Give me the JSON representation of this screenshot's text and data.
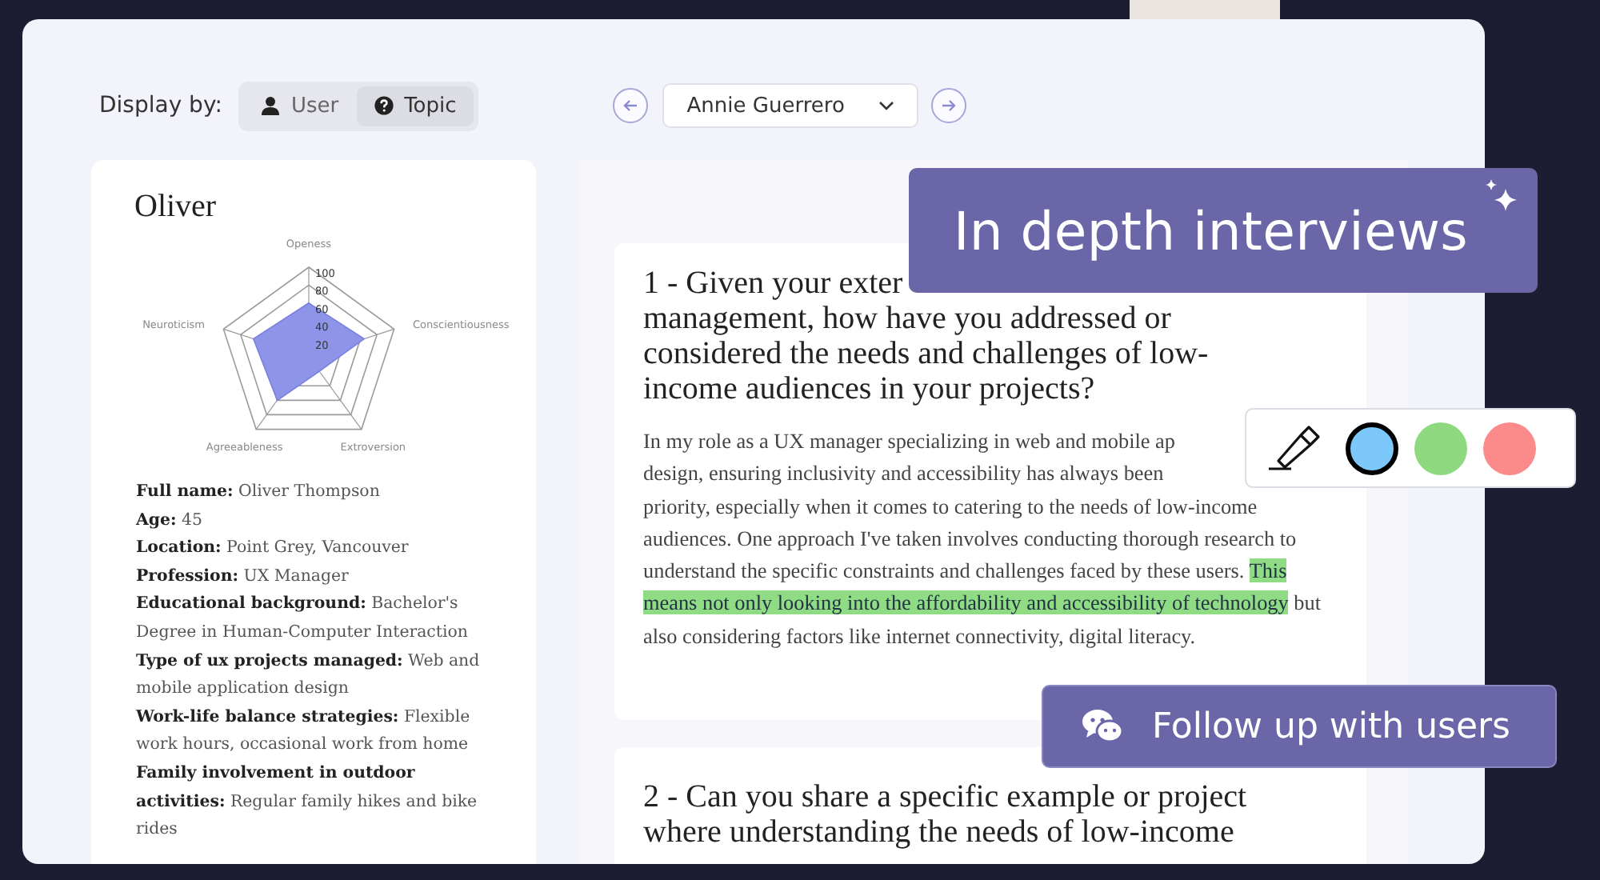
{
  "toolbar": {
    "label": "Display by:",
    "view_toggle": [
      {
        "kind": "user",
        "label": "User",
        "selected": false
      },
      {
        "kind": "topic",
        "label": "Topic",
        "selected": true
      }
    ],
    "participant": {
      "value": "Annie Guerrero"
    }
  },
  "profile": {
    "name": "Oliver",
    "radar_chart": {
      "axis_labels": [
        "Openess",
        "Conscientiousness",
        "Extroversion",
        "Agreeableness",
        "Neuroticism"
      ],
      "tick_labels": [
        "100",
        "80",
        "60",
        "40",
        "20"
      ]
    },
    "fields": [
      {
        "label": "Full name:",
        "value": "Oliver Thompson"
      },
      {
        "label": "Age:",
        "value": "45"
      },
      {
        "label": "Location:",
        "value": "Point Grey, Vancouver"
      },
      {
        "label": "Profession:",
        "value": "UX Manager"
      },
      {
        "label": "Educational background:",
        "value": "Bachelor's Degree in Human-Computer Interaction"
      },
      {
        "label": "Type of ux projects managed:",
        "value": "Web and mobile application design"
      },
      {
        "label": "Work-life balance strategies:",
        "value": "Flexible work hours, occasional work from home"
      },
      {
        "label": "Family involvement in outdoor activities:",
        "value": "Regular family hikes and bike rides"
      }
    ]
  },
  "questions": [
    {
      "heading": [
        "1 - Given your exter",
        "management, how have you addressed or considered the needs and challenges of low-income audiences in your projects?"
      ],
      "answer_lines": [
        "In my role as a UX manager specializing in web and mobile ap",
        "design, ensuring inclusivity and accessibility has always been"
      ],
      "answer": [
        {
          "text": "priority, especially when it comes to catering to the needs of low-income audiences. One approach I've taken involves conducting thorough research to understand the specific constraints and challenges faced by these users. "
        },
        {
          "text": "This means not only looking into the affordability and accessibility of technology",
          "color": "#8fdc84"
        },
        {
          "text": " but also considering factors like internet connectivity, digital literacy."
        }
      ]
    },
    {
      "heading": [
        "2 - Can you share a specific example or project where understanding the needs of low-income"
      ]
    }
  ],
  "banner": {
    "title": "In depth interviews"
  },
  "highlighter": {
    "colors": [
      {
        "color": "#7cc8fa",
        "selected": true
      },
      {
        "color": "#8ed97f",
        "selected": false
      },
      {
        "color": "#fb8b8b",
        "selected": false
      }
    ]
  },
  "follow_up_button": {
    "label": "Follow up with users"
  }
}
